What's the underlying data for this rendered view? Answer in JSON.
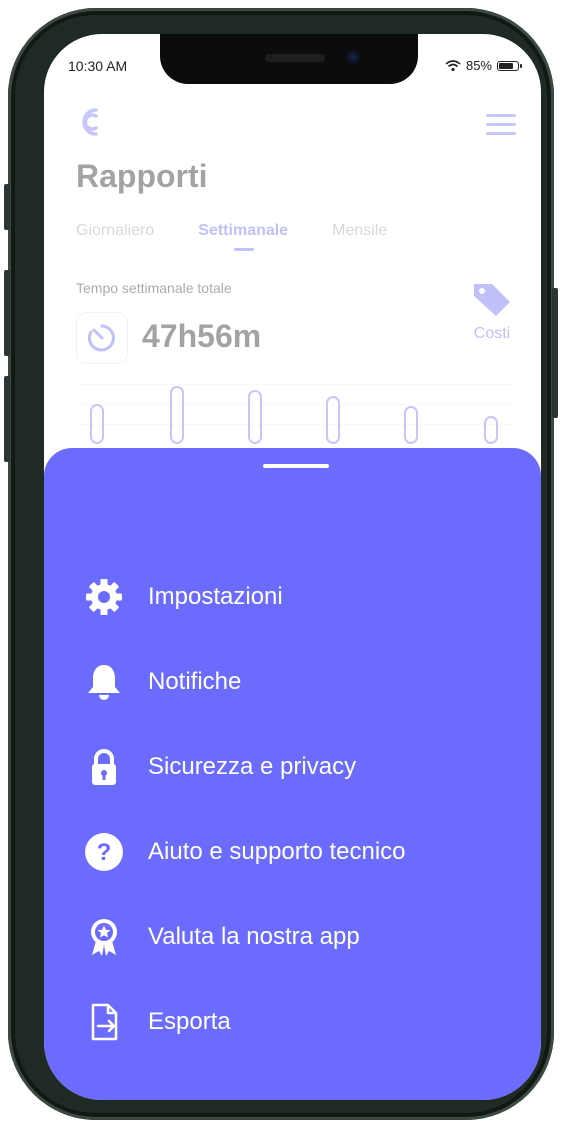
{
  "status_bar": {
    "time": "10:30 AM",
    "battery": "85%"
  },
  "header": {
    "logo_icon": "app-logo-icon",
    "menu_icon": "hamburger-icon"
  },
  "page": {
    "title": "Rapporti",
    "tabs": [
      {
        "label": "Giornaliero",
        "active": false
      },
      {
        "label": "Settimanale",
        "active": true
      },
      {
        "label": "Mensile",
        "active": false
      }
    ],
    "weekly_label": "Tempo settimanale totale",
    "total_time": "47h56m",
    "costs_label": "Costi"
  },
  "colors": {
    "accent": "#6b6bfd",
    "sheet_text": "#ffffff"
  },
  "menu": {
    "items": [
      {
        "label": "Impostazioni",
        "icon": "gear-icon"
      },
      {
        "label": "Notifiche",
        "icon": "bell-icon"
      },
      {
        "label": "Sicurezza e privacy",
        "icon": "lock-icon"
      },
      {
        "label": "Aiuto e supporto tecnico",
        "icon": "help-icon"
      },
      {
        "label": "Valuta la nostra app",
        "icon": "badge-star-icon"
      },
      {
        "label": "Esporta",
        "icon": "export-icon"
      }
    ]
  }
}
